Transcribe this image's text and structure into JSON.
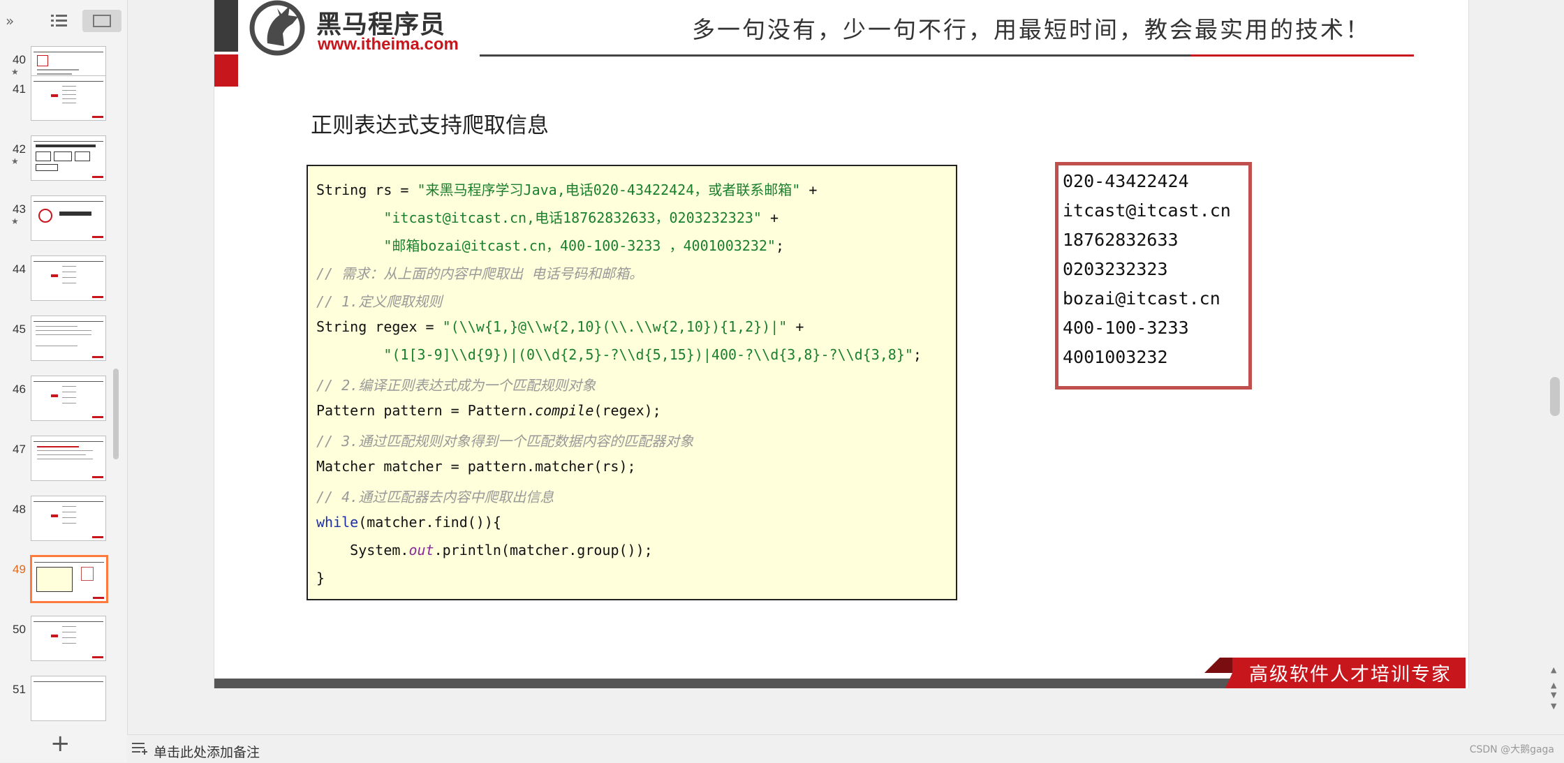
{
  "sidebar": {
    "thumbnails": [
      {
        "num": "40",
        "star": true
      },
      {
        "num": "41",
        "star": false
      },
      {
        "num": "42",
        "star": true
      },
      {
        "num": "43",
        "star": true
      },
      {
        "num": "44",
        "star": false
      },
      {
        "num": "45",
        "star": false
      },
      {
        "num": "46",
        "star": false
      },
      {
        "num": "47",
        "star": false
      },
      {
        "num": "48",
        "star": false
      },
      {
        "num": "49",
        "star": false,
        "active": true
      },
      {
        "num": "50",
        "star": false
      },
      {
        "num": "51",
        "star": false
      }
    ],
    "star_glyph": "★",
    "add_glyph": "+"
  },
  "slide": {
    "logo_cn": "黑马程序员",
    "logo_url": "www.itheima.com",
    "slogan": "多一句没有，少一句不行，用最短时间，教会最实用的技术！",
    "title": "正则表达式支持爬取信息",
    "footer": "高级软件人才培训专家",
    "code": {
      "l1a": "String rs = ",
      "l1b": "\"来黑马程序学习Java,电话020-43422424，或者联系邮箱\"",
      "l1c": " +",
      "l2a": "        ",
      "l2b": "\"itcast@itcast.cn,电话18762832633，0203232323\"",
      "l2c": " +",
      "l3a": "        ",
      "l3b": "\"邮箱bozai@itcast.cn，400-100-3233 ，4001003232\"",
      "l3c": ";",
      "l4": "// 需求：从上面的内容中爬取出 电话号码和邮箱。",
      "l5": "// 1.定义爬取规则",
      "l6a": "String regex = ",
      "l6b": "\"(\\\\w{1,}@\\\\w{2,10}(\\\\.\\\\w{2,10}){1,2})|\"",
      "l6c": " +",
      "l7a": "        ",
      "l7b": "\"(1[3-9]\\\\d{9})|(0\\\\d{2,5}-?\\\\d{5,15})|400-?\\\\d{3,8}-?\\\\d{3,8}\"",
      "l7c": ";",
      "l8": "// 2.编译正则表达式成为一个匹配规则对象",
      "l9a": "Pattern pattern = Pattern.",
      "l9b": "compile",
      "l9c": "(regex);",
      "l10": "// 3.通过匹配规则对象得到一个匹配数据内容的匹配器对象",
      "l11": "Matcher matcher = pattern.matcher(rs);",
      "l12": "// 4.通过匹配器去内容中爬取出信息",
      "l13a": "while",
      "l13b": "(matcher.find()){",
      "l14a": "    System.",
      "l14b": "out",
      "l14c": ".println(matcher.group());",
      "l15": "}"
    },
    "output": [
      "020-43422424",
      "itcast@itcast.cn",
      "18762832633",
      "0203232323",
      "bozai@itcast.cn",
      "400-100-3233",
      "4001003232"
    ]
  },
  "notes": {
    "placeholder": "单击此处添加备注"
  },
  "watermark": "CSDN @大鹅gaga",
  "colors": {
    "brand_red": "#c8161d",
    "code_bg": "#ffffdb",
    "output_border": "#c0504d",
    "active_thumb": "#ff7a3d"
  }
}
